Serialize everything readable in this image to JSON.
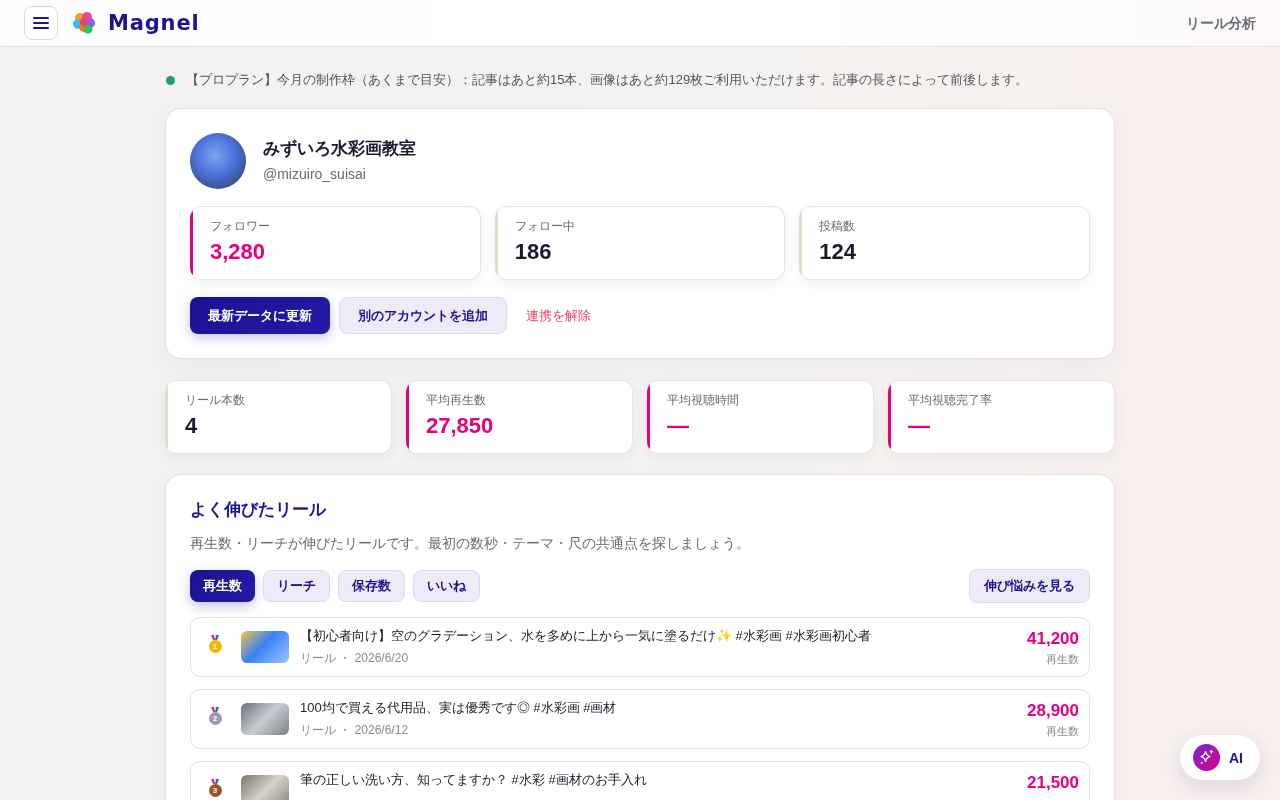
{
  "header": {
    "logo_text": "Magnel",
    "nav_link": "リール分析"
  },
  "notice": {
    "text": "【プロプラン】今月の制作枠（あくまで目安）：記事はあと約15本、画像はあと約129枚ご利用いただけます。記事の長さによって前後します。"
  },
  "profile": {
    "name": "みずいろ水彩画教室",
    "handle": "@mizuiro_suisai",
    "stats": [
      {
        "label": "フォロワー",
        "value": "3,280",
        "highlighted": true
      },
      {
        "label": "フォロー中",
        "value": "186",
        "highlighted": false
      },
      {
        "label": "投稿数",
        "value": "124",
        "highlighted": false
      }
    ],
    "actions": [
      {
        "label": "最新データに更新",
        "kind": "primary"
      },
      {
        "label": "別のアカウントを追加",
        "kind": "secondary"
      },
      {
        "label": "連携を解除",
        "kind": "danger"
      }
    ]
  },
  "summary_stats": [
    {
      "label": "リール本数",
      "value": "4",
      "highlighted": false
    },
    {
      "label": "平均再生数",
      "value": "27,850",
      "highlighted": true
    },
    {
      "label": "平均視聴時間",
      "value": "—",
      "highlighted": true
    },
    {
      "label": "平均視聴完了率",
      "value": "—",
      "highlighted": true
    }
  ],
  "top_reels": {
    "title": "よく伸びたリール",
    "description": "再生数・リーチが伸びたリールです。最初の数秒・テーマ・尺の共通点を探しましょう。",
    "tabs": [
      {
        "label": "再生数",
        "selected": true
      },
      {
        "label": "リーチ",
        "selected": false
      },
      {
        "label": "保存数",
        "selected": false
      },
      {
        "label": "いいね",
        "selected": false
      }
    ],
    "side_button": "伸び悩みを見る",
    "items": [
      {
        "rank": "1",
        "color": "#f2b705",
        "title": "【初心者向け】空のグラデーション、水を多めに上から一気に塗るだけ✨ #水彩画 #水彩画初心者",
        "meta": "リール ・ 2026/6/20",
        "value": "41,200",
        "unit": "再生数"
      },
      {
        "rank": "2",
        "color": "#9a9bb0",
        "title": "100均で買える代用品、実は優秀です◎ #水彩画 #画材",
        "meta": "リール ・ 2026/6/12",
        "value": "28,900",
        "unit": "再生数"
      },
      {
        "rank": "3",
        "color": "#a0522d",
        "title": "筆の正しい洗い方、知ってますか？ #水彩 #画材のお手入れ",
        "value": "21,500"
      }
    ]
  },
  "ai_button": {
    "label": "AI"
  }
}
